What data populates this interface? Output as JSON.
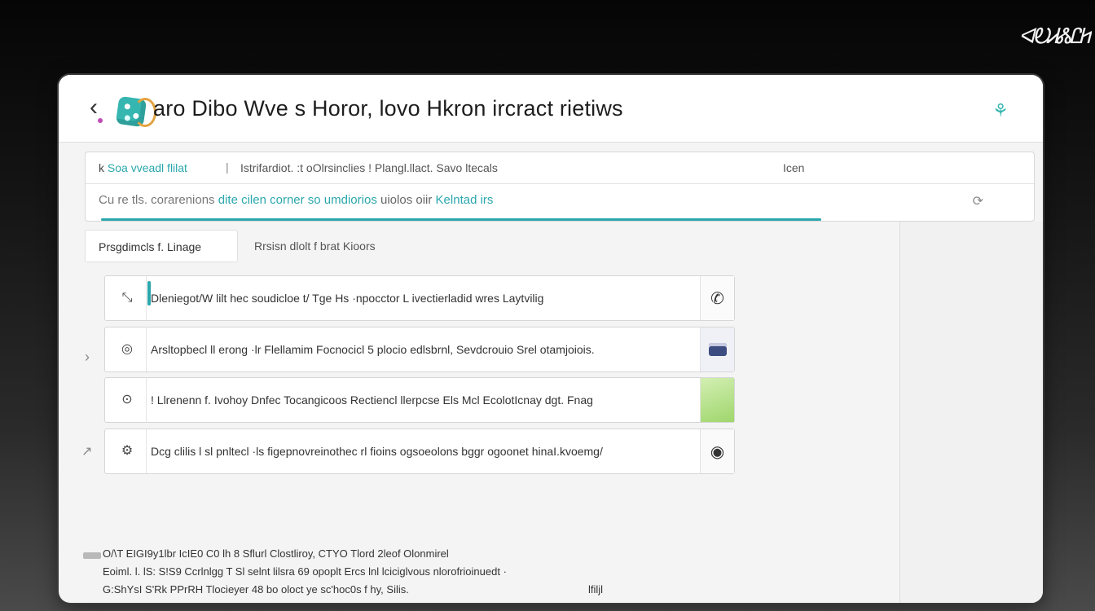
{
  "corner_logo": "ᐊᎧᏗᏜᏝᏥ",
  "header": {
    "back_icon": "back-arrow-icon",
    "title": "aro Dibo Wve s Horor, lovo Hkron ircract rietiws",
    "right_icon": "app-settings-icon"
  },
  "info": {
    "breadcrumb_prefix": "k",
    "breadcrumb_accent": "Soa vveadl flilat",
    "breadcrumb_sep": "|",
    "breadcrumb_secondary": "Istrifardiot. :t oOlrsinclies ! Plangl.llact. Savo ltecals",
    "action": "Icen",
    "status_prefix": "Cu re tls. corarenions",
    "status_highlight": "dite cilen corner so umdiorios",
    "status_mid": "uiolos oiir",
    "status_highlight2": "Kelntad irs",
    "status_icon": "refresh-icon",
    "progress": 1.0
  },
  "tabs": {
    "active": "Prsgdimcls f. Linage",
    "inactive": "Rrsisn dlolt f brat Kioors"
  },
  "list": {
    "items": [
      {
        "icon": "link-icon",
        "text": "Dleniegot/W lilt hec soudicloe  t/ Tge Hs ·npocctor L ivectierladid wres Laytvilig",
        "thumb": "contact-icon"
      },
      {
        "icon": "target-icon",
        "text": "Arsltopbecl ll erong ·lr Flellamim Focnocicl 5 plocio  edlsbrnl, Sevdcrouio Srel otamjoiois.",
        "thumb": "device-icon"
      },
      {
        "icon": "badge-icon",
        "text": "! Llrenenn f. Ivohoy Dnfec Tocangicoos Rectiencl llerpcse Els Mcl EcolotIcnay dgt. Fnag",
        "thumb": "landscape-thumb"
      },
      {
        "icon": "gear-icon",
        "text": "Dcg clilis l sl pnltecl ·ls figepnovreinothec rl fioins ogsoeolons bggr ogoonet hinaI.kvoemg/",
        "thumb": "circle-icon"
      }
    ]
  },
  "footer": {
    "line1": "O/\\T EIGI9y1lbr IcIE0 C0 lh 8 Sflurl Clostliroy, CTYO Tlord 2leof Olonmirel",
    "line2": "Eoiml. l. lS:  S!S9 Ccrlnlgg T Sl selnt lilsra 69 opoplt Ercs lnl lciciglvous nlorofrioinuedt ·",
    "line3": "G:ShYsI  S'Rk PPrRH Tlocieyer 48 bo oloct ye sc'hoc0s f hy, Silis.",
    "ref": "lfiljl"
  }
}
